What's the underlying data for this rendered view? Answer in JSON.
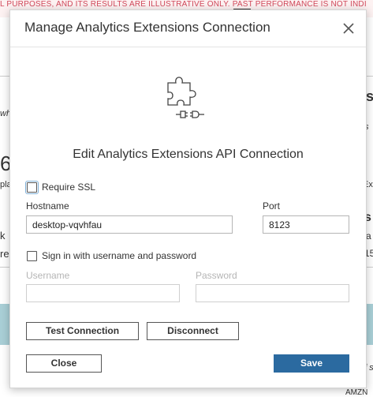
{
  "background": {
    "banner_text": "L PURPOSES, AND ITS RESULTS ARE ILLUSTRATIVE ONLY. PAST PERFORMANCE IS NOT INDI",
    "right_fragments": [
      "s",
      "s",
      "Ex",
      "s",
      "a",
      "15",
      "s",
      "f s",
      "AMZN"
    ],
    "left_fragments": [
      "wh",
      "6",
      "pla",
      "k",
      "re"
    ]
  },
  "dialog": {
    "title": "Manage Analytics Extensions Connection",
    "section_title": "Edit Analytics Extensions API Connection",
    "require_ssl": {
      "label": "Require SSL",
      "checked": false
    },
    "hostname": {
      "label": "Hostname",
      "value": "desktop-vqvhfau"
    },
    "port": {
      "label": "Port",
      "value": "8123"
    },
    "sign_in": {
      "label": "Sign in with username and password",
      "checked": false
    },
    "username": {
      "label": "Username",
      "value": ""
    },
    "password": {
      "label": "Password",
      "value": ""
    },
    "buttons": {
      "test_connection": "Test Connection",
      "disconnect": "Disconnect",
      "close": "Close",
      "save": "Save"
    }
  },
  "colors": {
    "banner_text": "#d1495b",
    "primary_button": "#2b6aa0",
    "bg_strip": "#a9cfd6"
  },
  "icons": [
    "close-icon",
    "plugin-icon"
  ]
}
